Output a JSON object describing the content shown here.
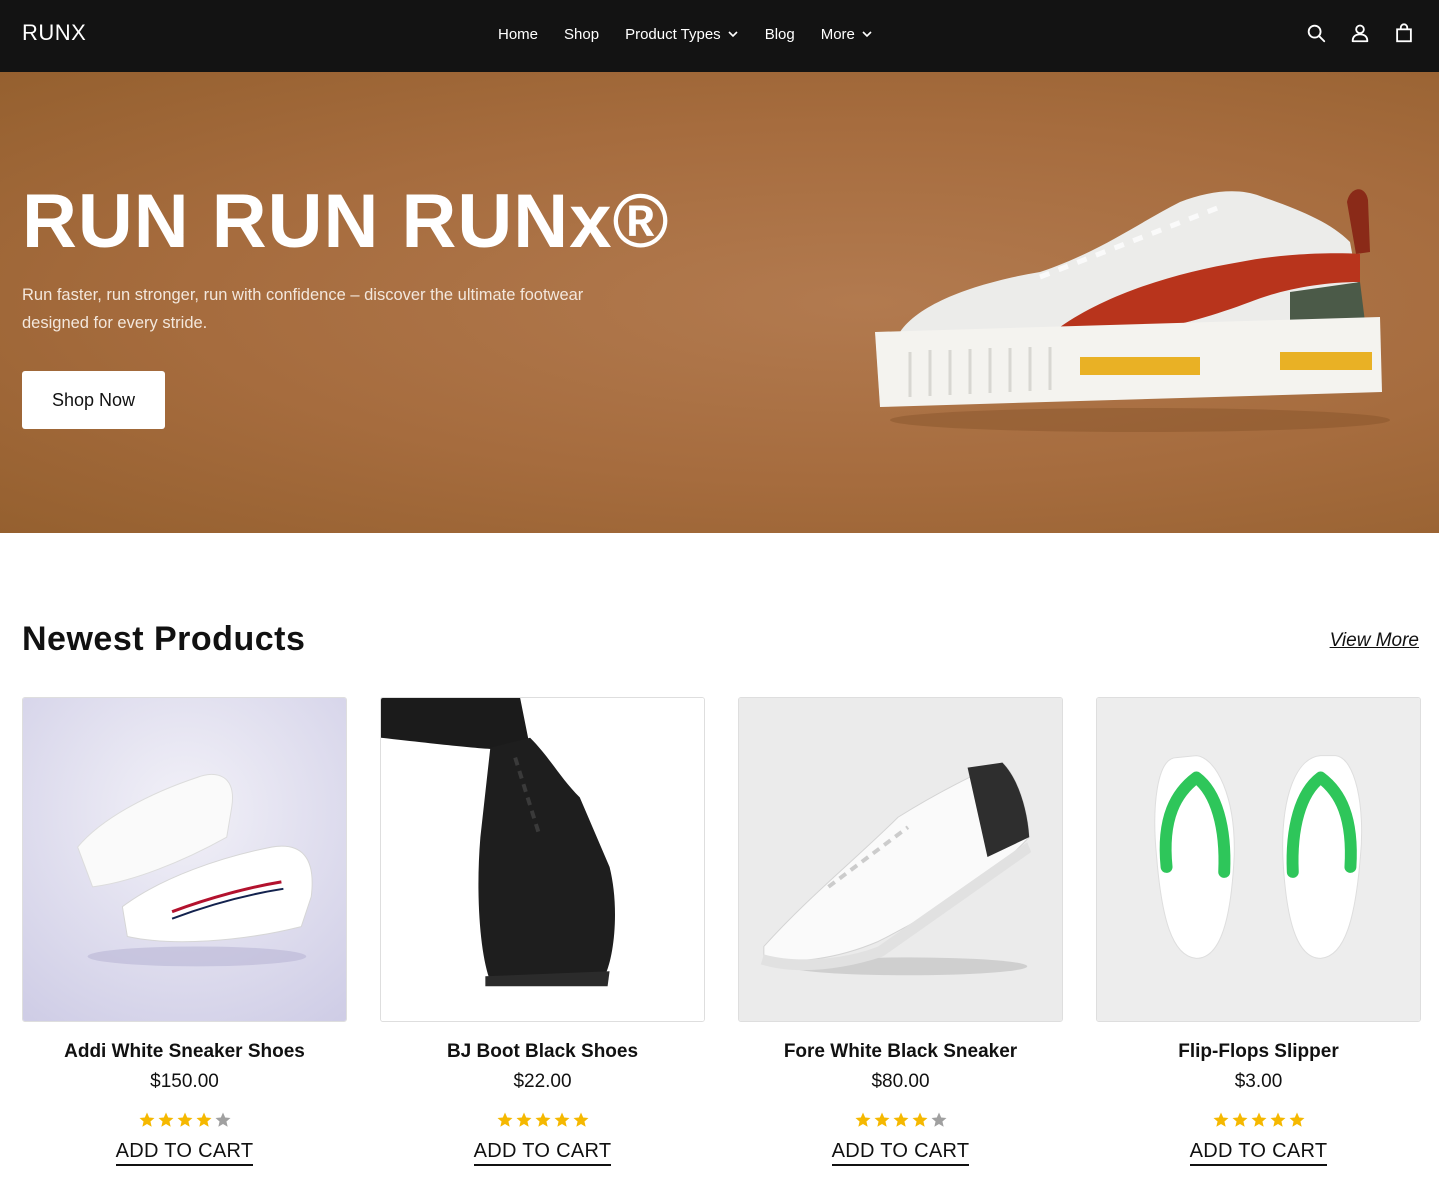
{
  "header": {
    "logo": "RUNX",
    "nav": [
      {
        "label": "Home",
        "has_dropdown": false
      },
      {
        "label": "Shop",
        "has_dropdown": false
      },
      {
        "label": "Product Types",
        "has_dropdown": true
      },
      {
        "label": "Blog",
        "has_dropdown": false
      },
      {
        "label": "More",
        "has_dropdown": true
      }
    ],
    "icons": [
      "search-icon",
      "account-icon",
      "cart-bag-icon"
    ]
  },
  "hero": {
    "title": "RUN RUN RUNx®",
    "subtitle": "Run faster, run stronger, run with confidence – discover the ultimate footwear designed for every stride.",
    "cta_label": "Shop Now",
    "background_color": "#a66c3e"
  },
  "newest": {
    "title": "Newest Products",
    "view_more_label": "View More",
    "products": [
      {
        "name": "Addi White Sneaker Shoes",
        "price": "$150.00",
        "rating": 4,
        "max_rating": 5,
        "cta": "ADD TO CART"
      },
      {
        "name": "BJ Boot Black Shoes",
        "price": "$22.00",
        "rating": 5,
        "max_rating": 5,
        "cta": "ADD TO CART"
      },
      {
        "name": "Fore White Black Sneaker",
        "price": "$80.00",
        "rating": 4,
        "max_rating": 5,
        "cta": "ADD TO CART"
      },
      {
        "name": "Flip-Flops Slipper",
        "price": "$3.00",
        "rating": 5,
        "max_rating": 5,
        "cta": "ADD TO CART"
      }
    ]
  },
  "colors": {
    "header_bg": "#131313",
    "star_filled": "#f5b800",
    "star_empty": "#a0a0a0"
  }
}
